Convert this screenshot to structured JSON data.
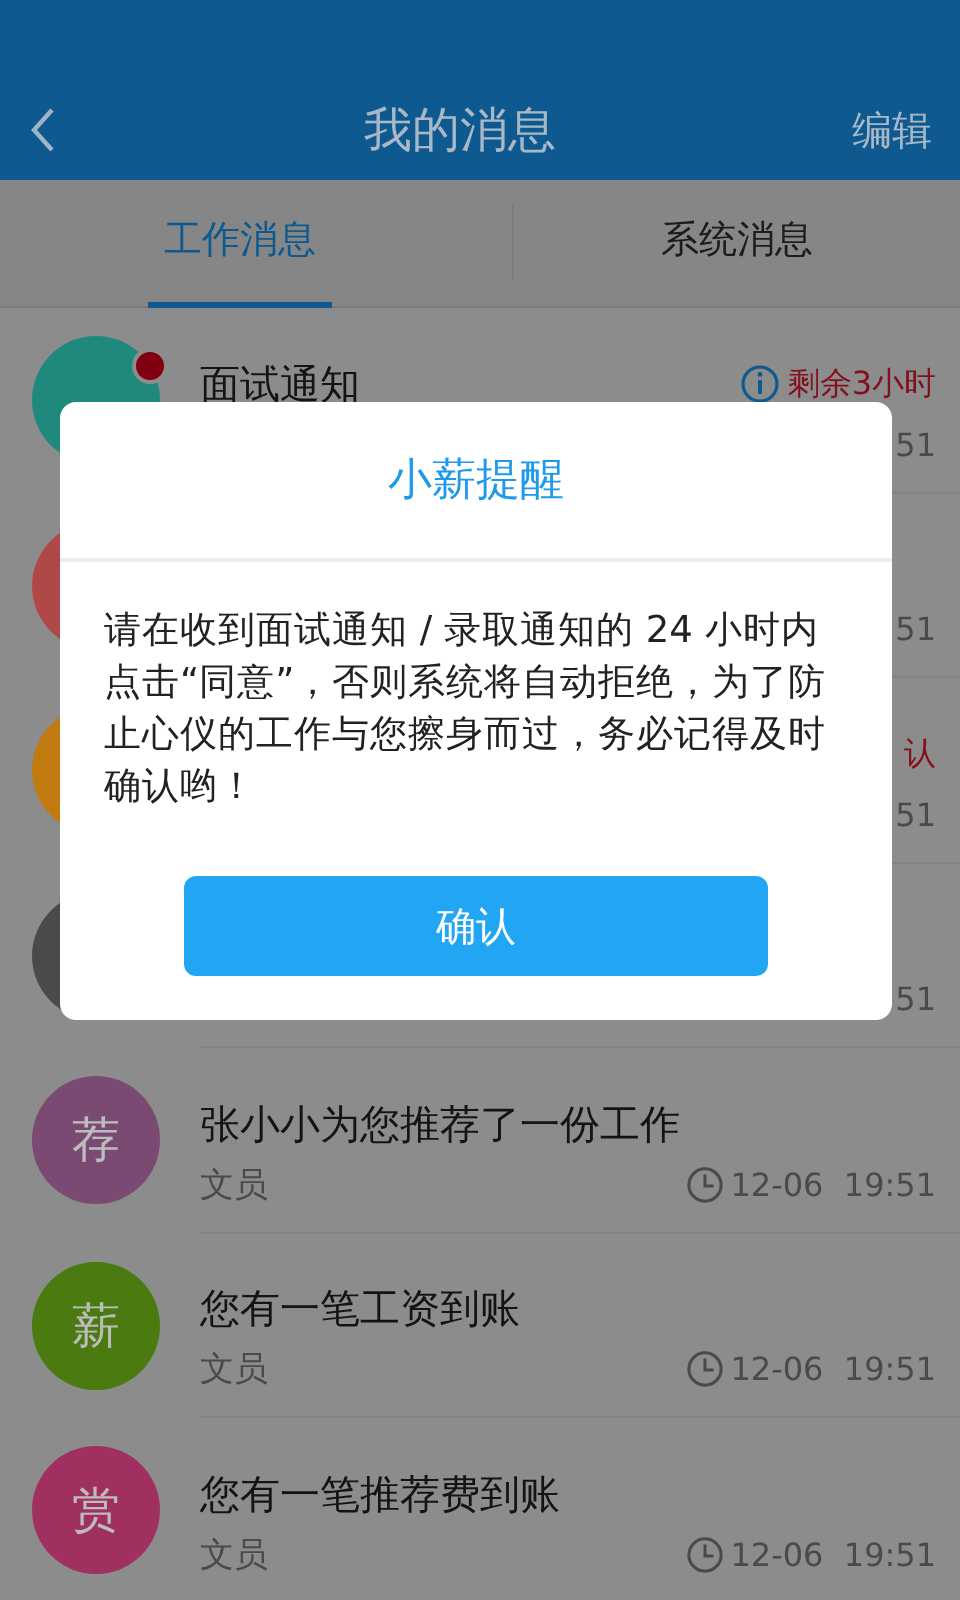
{
  "header": {
    "title": "我的消息",
    "action": "编辑"
  },
  "tabs": [
    {
      "label": "工作消息",
      "selected": true
    },
    {
      "label": "系统消息",
      "selected": false
    }
  ],
  "messages": [
    {
      "color": "#1f8a7c",
      "unread": true,
      "title": "面试通知",
      "info_icon": true,
      "deadline": "剩余3小时",
      "clock": false,
      "time": "51"
    },
    {
      "color": "#b04848",
      "unread": false,
      "clock": false,
      "time": "51"
    },
    {
      "color": "#c07a10",
      "unread": false,
      "deadline": "认",
      "clock": false,
      "time": "51"
    },
    {
      "color": "#4a4a4a",
      "unread": false,
      "clock": false,
      "time": "51"
    },
    {
      "avatar": "荐",
      "color": "#7a4a72",
      "unread": false,
      "title": "张小小为您推荐了一份工作",
      "subtitle": "文员",
      "clock": true,
      "time": "12-06  19:51"
    },
    {
      "avatar": "薪",
      "color": "#4a7a10",
      "unread": false,
      "title": "您有一笔工资到账",
      "subtitle": "文员",
      "clock": true,
      "time": "12-06  19:51"
    },
    {
      "avatar": "赏",
      "color": "#a03060",
      "unread": false,
      "title": "您有一笔推荐费到账",
      "subtitle": "文员",
      "clock": true,
      "time": "12-06  19:51"
    }
  ],
  "dialog": {
    "title": "小薪提醒",
    "body": "请在收到面试通知 / 录取通知的 24 小时内点击“同意”，否则系统将自动拒绝，为了防止心仪的工作与您擦身而过，务必记得及时确认哟！",
    "button": "确认"
  }
}
